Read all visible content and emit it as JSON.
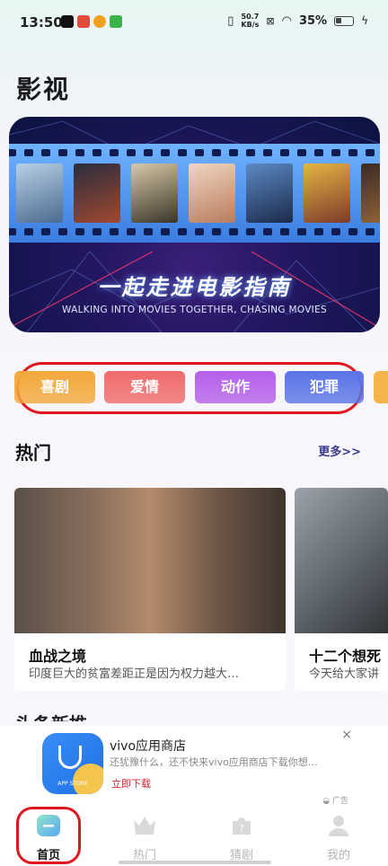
{
  "status_bar": {
    "time": "13:50",
    "net_speed_value": "50.7",
    "net_speed_unit": "KB/s",
    "battery": "35%"
  },
  "page_title": "影视",
  "banner": {
    "title": "一起走进电影指南",
    "subtitle": "WALKING INTO MOVIES TOGETHER, CHASING MOVIES"
  },
  "categories": [
    {
      "label": "喜剧",
      "color": "#f3a83a"
    },
    {
      "label": "爱情",
      "color": "#f06b6b"
    },
    {
      "label": "动作",
      "color": "#b560ea"
    },
    {
      "label": "犯罪",
      "color": "#5a74e6"
    }
  ],
  "hot": {
    "title": "热门",
    "more": "更多>>",
    "cards": [
      {
        "title": "血战之境",
        "desc": "印度巨大的贫富差距正是因为权力越大…"
      },
      {
        "title": "十二个想死",
        "desc": "今天给大家讲"
      }
    ]
  },
  "next_section": "头条新推",
  "ad": {
    "app_name": "vivo应用商店",
    "desc": "还犹豫什么，还不快来vivo应用商店下载你想…",
    "download": "立即下载",
    "logo_text": "APP STORE",
    "close": "×",
    "tag": "广告"
  },
  "tabs": [
    {
      "label": "首页",
      "active": true
    },
    {
      "label": "热门",
      "active": false
    },
    {
      "label": "猜剧",
      "active": false
    },
    {
      "label": "我的",
      "active": false
    }
  ],
  "colors": {
    "highlight_outline": "#e0161e",
    "accent": "#3b3b8c"
  }
}
